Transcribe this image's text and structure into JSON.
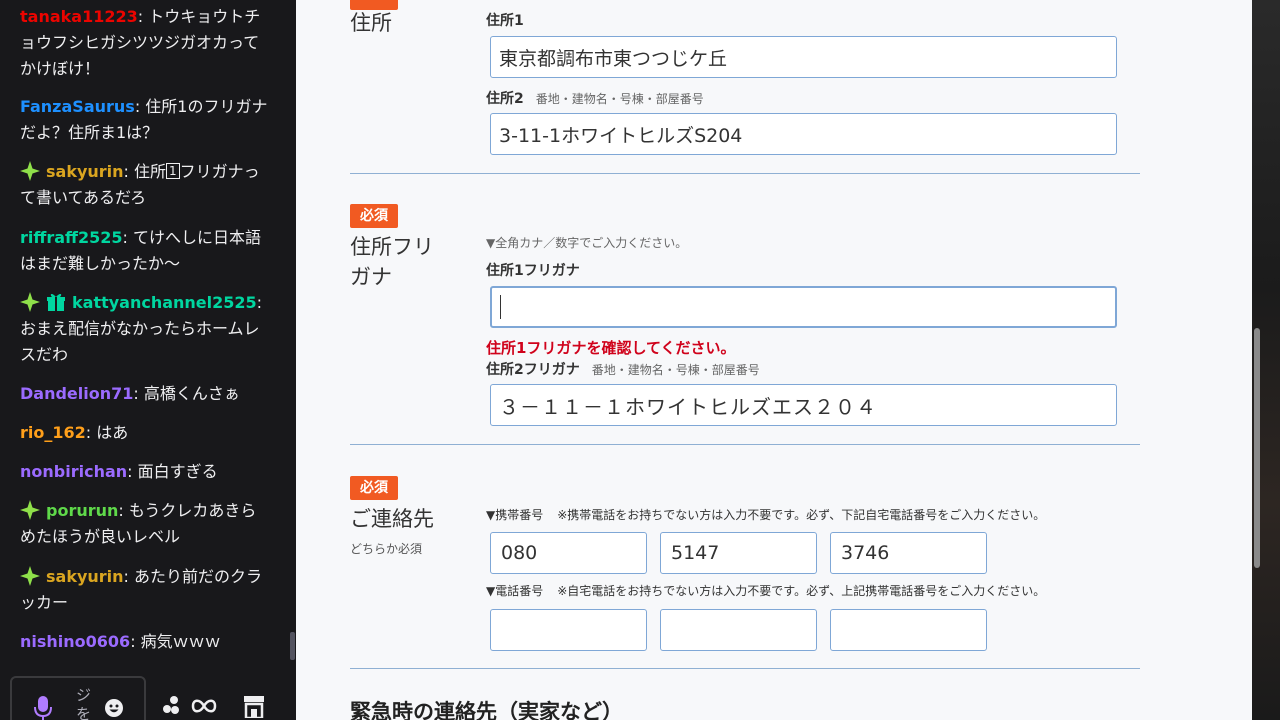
{
  "chat": {
    "messages": [
      {
        "user": "tanaka11223",
        "color": "#eb0400",
        "text": ": トウキョウトチョウフシヒガシツツジガオカってかけぼけ！",
        "badge": null
      },
      {
        "user": "FanzaSaurus",
        "color": "#1e90ff",
        "text": ": 住所1のフリガナだよ？住所ま1は？",
        "badge": null
      },
      {
        "user": "sakyurin",
        "color": "#daa520",
        "text_before": ": 住所",
        "kbd": "1",
        "text_after": "フリガナって書いてあるだろ",
        "badge": "sparkle"
      },
      {
        "user": "riffraff2525",
        "color": "#00d6a0",
        "text": ": てけへしに日本語はまだ難しかったか～",
        "badge": null
      },
      {
        "user": "kattyanchannel2525",
        "color": "#00d6a0",
        "text": ": おまえ配信がなかったらホームレスだわ",
        "badge": "sparkle+gift"
      },
      {
        "user": "Dandelion71",
        "color": "#9b6bff",
        "text": ": 高橋くんさぁ",
        "badge": null
      },
      {
        "user": "rio_162",
        "color": "#ff9f1a",
        "text": ": はあ",
        "badge": null
      },
      {
        "user": "nonbirichan",
        "color": "#9b6bff",
        "text": ": 面白すぎる",
        "badge": null
      },
      {
        "user": "porurun",
        "color": "#5fd94a",
        "text": ": もうクレカあきらめたほうが良いレベル",
        "badge": "sparkle"
      },
      {
        "user": "sakyurin",
        "color": "#daa520",
        "text": ": あたり前だのクラッカー",
        "badge": "sparkle"
      },
      {
        "user": "nishino0606",
        "color": "#9b6bff",
        "text": ": 病気ｗｗｗ",
        "badge": null
      }
    ],
    "input_placeholder": "ジを",
    "icons": [
      "mic-icon",
      "emoji-icon",
      "bits-icon",
      "infinity-icon",
      "store-icon"
    ]
  },
  "form": {
    "address": {
      "title": "住所",
      "address1_label": "住所1",
      "address1_value": "東京都調布市東つつじケ丘",
      "address2_label": "住所2",
      "address2_hint": "番地・建物名・号棟・部屋番号",
      "address2_value": "3-11-1ホワイトヒルズS204"
    },
    "furigana": {
      "required": "必須",
      "title_line1": "住所フリ",
      "title_line2": "ガナ",
      "note": "▼全角カナ／数字でご入力ください。",
      "furigana1_label": "住所1フリガナ",
      "furigana1_value": "",
      "error": "住所1フリガナを確認してください。",
      "furigana2_label": "住所2フリガナ",
      "furigana2_hint": "番地・建物名・号棟・部屋番号",
      "furigana2_value": "３－１１－１ホワイトヒルズエス２０４"
    },
    "contact": {
      "required": "必須",
      "title": "ご連絡先",
      "sub": "どちらか必須",
      "mobile_label": "▼携帯番号",
      "mobile_note": "※携帯電話をお持ちでない方は入力不要です。必ず、下記自宅電話番号をご入力ください。",
      "mobile": [
        "080",
        "5147",
        "3746"
      ],
      "phone_label": "▼電話番号",
      "phone_note": "※自宅電話をお持ちでない方は入力不要です。必ず、上記携帯電話番号をご入力ください。",
      "phone": [
        "",
        "",
        ""
      ]
    },
    "emergency_heading": "緊急時の連絡先（実家など）"
  },
  "colors": {
    "required_badge": "#f15a22",
    "error": "#d0021b",
    "input_border": "#7fa7d6"
  }
}
